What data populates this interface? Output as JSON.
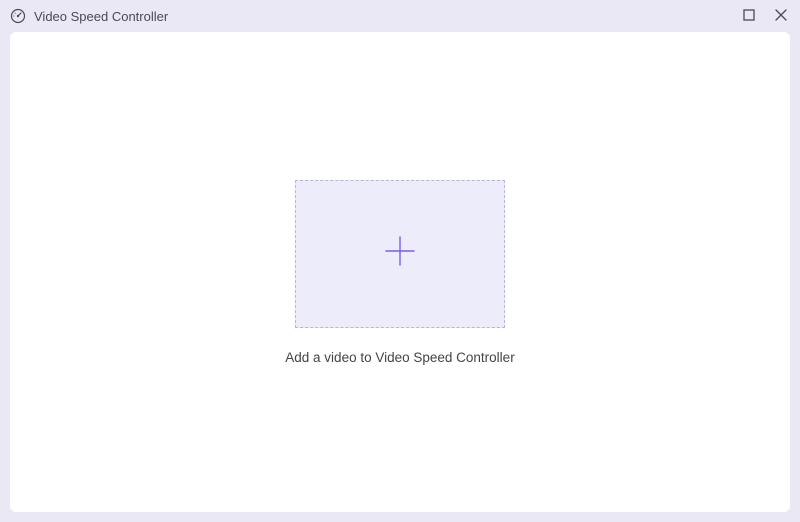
{
  "window": {
    "title": "Video Speed Controller"
  },
  "icons": {
    "app": "speed-gauge-icon",
    "maximize": "maximize-icon",
    "close": "close-icon",
    "plus": "plus-icon"
  },
  "main": {
    "instruction": "Add a video to Video Speed Controller"
  }
}
